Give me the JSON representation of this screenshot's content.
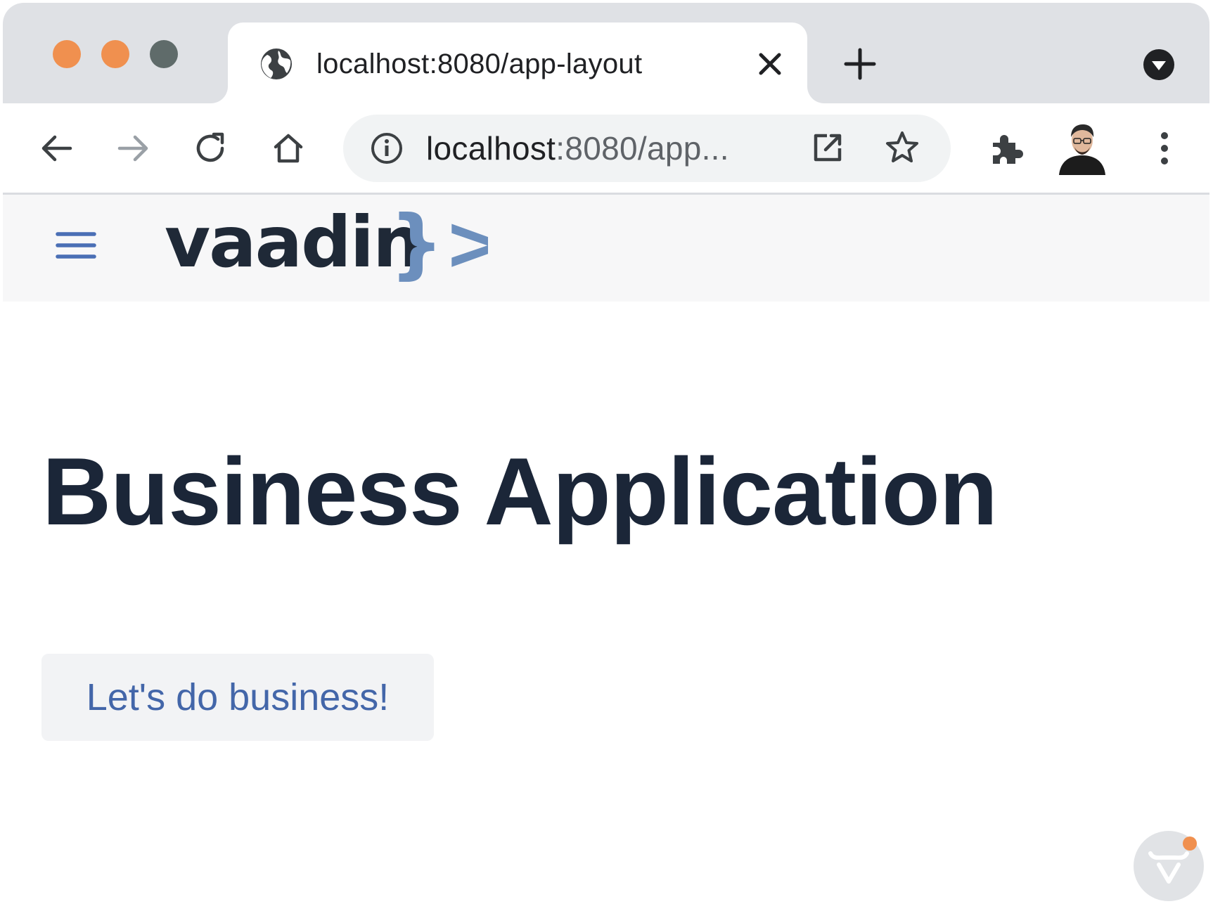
{
  "window": {
    "controls": [
      "close",
      "minimize",
      "zoom"
    ]
  },
  "tab": {
    "title": "localhost:8080/app-layout",
    "icon": "globe-icon"
  },
  "toolbar": {
    "back_icon": "back-arrow-icon",
    "forward_icon": "forward-arrow-icon",
    "reload_icon": "reload-icon",
    "home_icon": "home-icon",
    "extensions_icon": "puzzle-icon",
    "menu_icon": "kebab-menu-icon"
  },
  "omnibox": {
    "host": "localhost",
    "rest": ":8080/app..."
  },
  "app": {
    "logo_text": "vaadin",
    "logo_mark": "}>",
    "title": "Business Application",
    "button_label": "Let's do business!"
  },
  "colors": {
    "accent": "#4366a9",
    "logo_mark": "#6c8fbd",
    "traffic_light": "#f0904f",
    "title_text": "#1b2638"
  }
}
